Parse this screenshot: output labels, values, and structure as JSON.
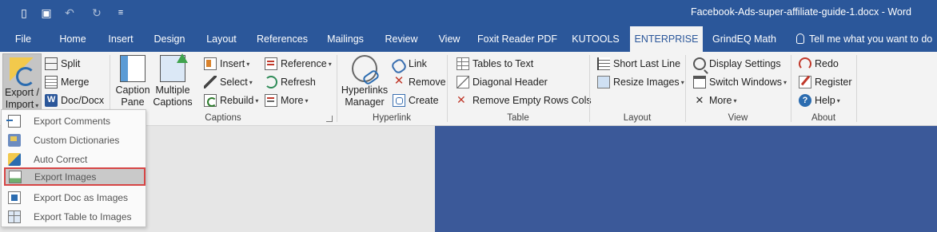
{
  "titlebar": {
    "title": "Facebook-Ads-super-affiliate-guide-1.docx  -  Word",
    "qa": {
      "new": "▯",
      "save": "▣",
      "undo": "↶",
      "redo": "↻",
      "customize": "≡"
    }
  },
  "tabs": [
    {
      "label": "File"
    },
    {
      "label": "Home"
    },
    {
      "label": "Insert"
    },
    {
      "label": "Design"
    },
    {
      "label": "Layout"
    },
    {
      "label": "References"
    },
    {
      "label": "Mailings"
    },
    {
      "label": "Review"
    },
    {
      "label": "View"
    },
    {
      "label": "Foxit Reader PDF"
    },
    {
      "label": "KUTOOLS"
    },
    {
      "label": "ENTERPRISE",
      "active": true
    },
    {
      "label": "GrindEQ Math"
    }
  ],
  "tellme": "Tell me what you want to do",
  "ribbon": {
    "export_import": "Export /",
    "export_import2": "Import",
    "split": "Split",
    "merge": "Merge",
    "doc_docx": "Doc/Docx",
    "caption_pane": "Caption",
    "caption_pane2": "Pane",
    "multiple_captions": "Multiple",
    "multiple_captions2": "Captions",
    "insert": "Insert",
    "select": "Select",
    "rebuild": "Rebuild",
    "reference": "Reference",
    "refresh": "Refresh",
    "more": "More",
    "captions_group": "Captions",
    "hyperlinks_manager": "Hyperlinks",
    "hyperlinks_manager2": "Manager",
    "link": "Link",
    "remove": "Remove",
    "create": "Create",
    "hyperlink_group": "Hyperlink",
    "tables_to_text": "Tables to Text",
    "diagonal_header": "Diagonal Header",
    "remove_empty_rows": "Remove Empty Rows Cols",
    "table_group": "Table",
    "short_last_line": "Short Last Line",
    "resize_images": "Resize Images",
    "layout_group": "Layout",
    "display_settings": "Display Settings",
    "switch_windows": "Switch Windows",
    "view_more": "More",
    "view_group": "View",
    "redo": "Redo",
    "register": "Register",
    "help": "Help",
    "about_group": "About"
  },
  "menu": [
    {
      "label": "Export Comments"
    },
    {
      "label": "Custom Dictionaries"
    },
    {
      "label": "Auto Correct"
    },
    {
      "label": "Export Images",
      "highlighted": true
    },
    {
      "label": "Export Doc as Images"
    },
    {
      "label": "Export Table to Images"
    }
  ],
  "colors": {
    "brand": "#2b579a",
    "document": "#3b5999",
    "highlight_border": "#d64545"
  }
}
